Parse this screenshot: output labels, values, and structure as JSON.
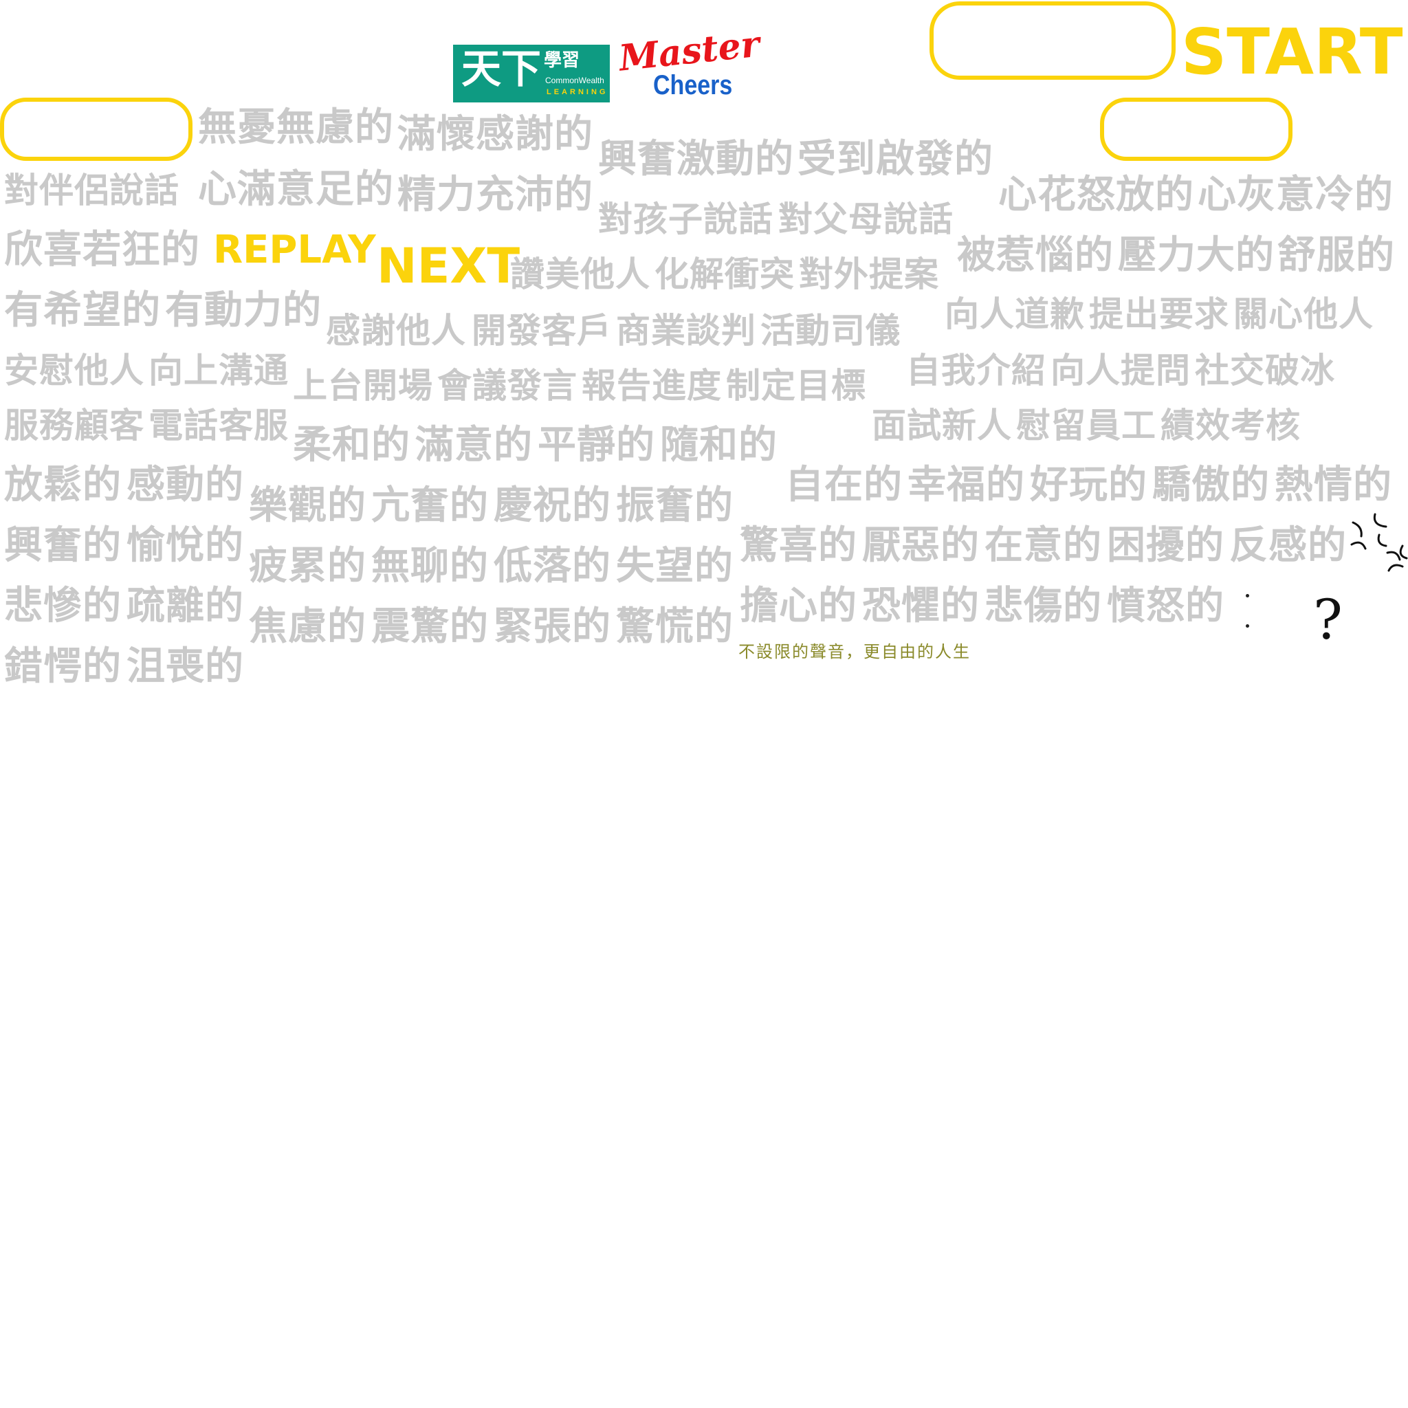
{
  "logos": {
    "commonwealth": {
      "chinese": "天下",
      "xuexi": "學習",
      "english": "CommonWealth",
      "learning": "LEARNING"
    },
    "master_cheers": {
      "master": "Master",
      "cheers": "Cheers"
    }
  },
  "buttons": {
    "start": "START",
    "replay": "REPLAY",
    "next": "NEXT"
  },
  "tagline": "不設限的聲音，更自由的人生",
  "question_mark": "?",
  "words": [
    "無憂無慮的",
    "滿懷感謝的",
    "興奮激動的",
    "受到啟發的",
    "對伴侶說話",
    "心滿意足的",
    "精力充沛的",
    "對孩子說話",
    "對父母說話",
    "心花怒放的",
    "心灰意冷的",
    "欣喜若狂的",
    "讚美他人",
    "化解衝突",
    "對外提案",
    "被惹惱的",
    "壓力大的",
    "舒服的",
    "有希望的",
    "有動力的",
    "感謝他人",
    "開發客戶",
    "商業談判",
    "活動司儀",
    "向人道歉",
    "提出要求",
    "關心他人",
    "安慰他人",
    "向上溝通",
    "上台開場",
    "會議發言",
    "報告進度",
    "制定目標",
    "自我介紹",
    "向人提問",
    "社交破冰",
    "服務顧客",
    "電話客服",
    "面試新人",
    "慰留員工",
    "績效考核",
    "柔和的",
    "滿意的",
    "平靜的",
    "隨和的",
    "放鬆的",
    "感動的",
    "自在的",
    "幸福的",
    "好玩的",
    "驕傲的",
    "熱情的",
    "樂觀的",
    "亢奮的",
    "慶祝的",
    "振奮的",
    "興奮的",
    "愉悅的",
    "驚喜的",
    "厭惡的",
    "在意的",
    "困擾的",
    "反感的",
    "疲累的",
    "無聊的",
    "低落的",
    "失望的",
    "悲慘的",
    "疏離的",
    "擔心的",
    "恐懼的",
    "悲傷的",
    "憤怒的",
    "焦慮的",
    "震驚的",
    "緊張的",
    "驚慌的",
    "錯愕的",
    "沮喪的"
  ],
  "colors": {
    "accent_yellow": "#fbd30c",
    "word_gray": "#c9c9c9",
    "brand_green": "#0e9b82",
    "brand_red": "#e8151b",
    "brand_blue": "#1961c9"
  }
}
